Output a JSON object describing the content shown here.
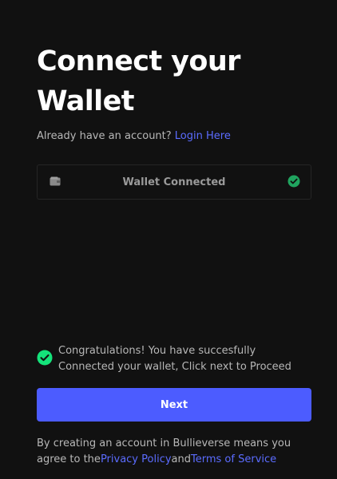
{
  "page": {
    "title_line1": "Connect your",
    "title_line2": "Wallet",
    "already_text": "Already have an account? ",
    "login_link": "Login Here"
  },
  "wallet": {
    "label": "Wallet Connected",
    "icon": "wallet-icon",
    "status_icon": "check-circle-icon"
  },
  "message": {
    "text": "Congratulations! You have succesfully Connected your wallet, Click next to Proceed",
    "icon": "check-circle-icon"
  },
  "button": {
    "next_label": "Next"
  },
  "footer": {
    "prefix": "By creating an account in Bullieverse means you agree to the",
    "privacy_link": "Privacy Policy",
    "and_text": "and",
    "terms_link": "Terms of Service"
  },
  "colors": {
    "background": "#111111",
    "accent": "#4c5cff",
    "link": "#5b6cff",
    "success": "#14e37a",
    "text_muted": "#b8b8b8"
  }
}
